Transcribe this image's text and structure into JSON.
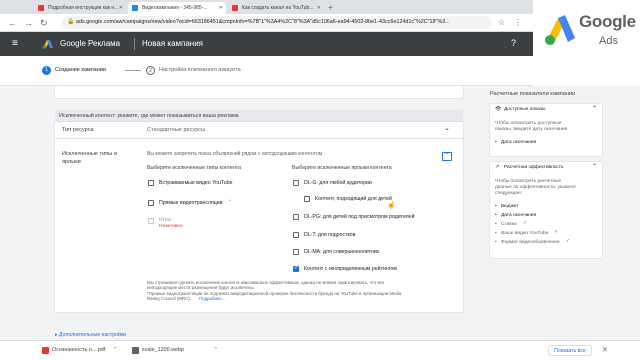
{
  "browser": {
    "tabs": [
      {
        "title": "Подробная инструкция как н...",
        "color": "#e53935"
      },
      {
        "title": "Видеокампания - 345-985-...",
        "color": "#1e88e5"
      },
      {
        "title": "Как создать канал на YouTub...",
        "color": "#e53935"
      }
    ],
    "url": "ads.google.com/aw/campaigns/new/video?ocid=663186451&cmpnInfo=%7B\"1\"%3A4%2C\"8\"%3A\"d5c106a6-ea94-4502-8be1-43cc6e124d1c\"%2C\"18\"%3..."
  },
  "header": {
    "brand": "Google Реклама",
    "page_title": "Новая кампания"
  },
  "watermark": {
    "line1": "Google",
    "line2": "Ads"
  },
  "steps": [
    {
      "num": "1",
      "label": "Создание кампании"
    },
    {
      "num": "2",
      "label": "Настройка платежного аккаунта"
    }
  ],
  "content": {
    "section_title": "Исключенный контент: укажите, где может показываться ваша реклама",
    "inventory_label": "Тип ресурса",
    "inventory_value": "Стандартные ресурсы",
    "excl_label_line1": "Исключенные типы и",
    "excl_label_line2": "ярлыки",
    "excl_description": "Вы можете запретить показ объявлений рядом с неподходящим контентом",
    "types_heading": "Выберите исключенные типы контента",
    "types": [
      {
        "label": "Встраиваемые видео YouTube",
        "checked": false
      },
      {
        "label": "Прямые видеотрансляции",
        "checked": false
      }
    ],
    "games_label": "Игры",
    "games_status": "Неактивно",
    "labels_heading": "Выберите исключенные ярлыки контента",
    "labels": [
      {
        "label": "DL-G: для любой аудитории",
        "checked": false
      },
      {
        "label": "Контент, подходящий для детей",
        "checked": false
      },
      {
        "label": "DL-PG: для детей под присмотром родителей",
        "checked": false
      },
      {
        "label": "DL-T: для подростков",
        "checked": false
      },
      {
        "label": "DL-MA: для совершеннолетних",
        "checked": false
      },
      {
        "label": "Контент с неопределенным рейтингом",
        "checked": true
      }
    ],
    "note_line1": "Мы стремимся сделать исключение контента максимально эффективным, однако не можем гарантировать, что все",
    "note_line2": "неподходящие места размещения будут исключены.",
    "note_line3": "*Прямые видеотрансляции не подлежат аккредитационной проверке безопасности бренда на YouTube в организации Media",
    "note_line4": "Rating Council (MRC).",
    "note_link": "Подробнее...",
    "more_settings": "Дополнительные настройки"
  },
  "rightpanel": {
    "title": "Расчетные показатели кампании",
    "card1_title": "Доступные показы",
    "card1_text1": "Чтобы посмотреть доступные",
    "card1_text2": "показы, введите дату окончания",
    "card1_item": "Дата окончания",
    "card2_title": "Расчетная эффективность",
    "card2_text1": "Чтобы посмотреть расчетные",
    "card2_text2": "данные по эффективности, укажите",
    "card2_text3": "следующее:",
    "card2_items": [
      {
        "label": "Бюджет",
        "done": false
      },
      {
        "label": "Дата окончания",
        "done": false
      },
      {
        "label": "Ставка",
        "done": true
      },
      {
        "label": "Ваше видео YouTube",
        "done": true
      },
      {
        "label": "Формат видеообъявления",
        "done": true
      }
    ]
  },
  "downloads": [
    {
      "name": "Осознанность н....pdf",
      "color": "#e53935"
    },
    {
      "name": "scale_1200.webp",
      "color": "#5f6368"
    }
  ],
  "downloads_showall": "Показать все"
}
